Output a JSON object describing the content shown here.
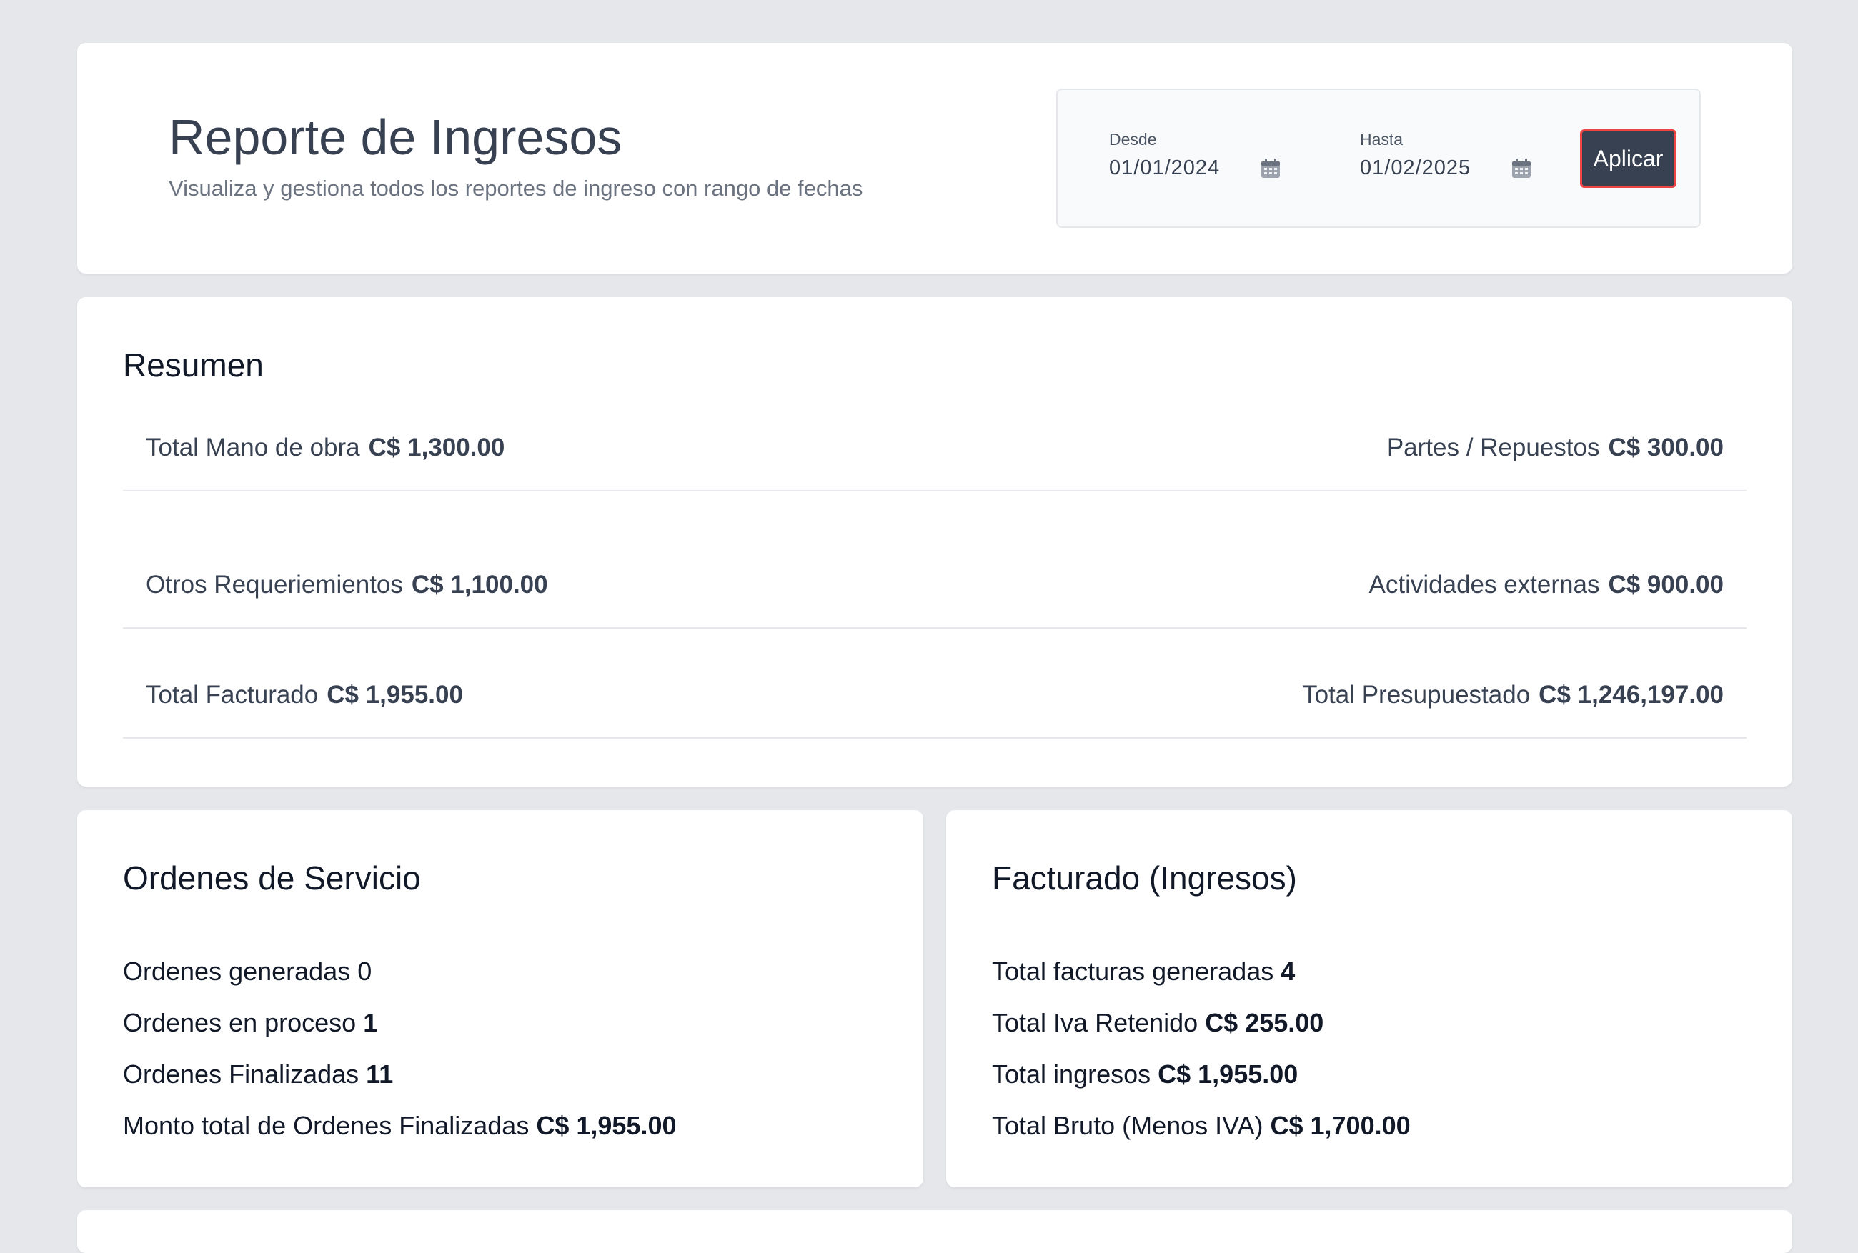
{
  "header": {
    "title": "Reporte de Ingresos",
    "subtitle": "Visualiza y gestiona todos los reportes de ingreso con rango de fechas"
  },
  "date_filter": {
    "from_label": "Desde",
    "from_value": "01/01/2024",
    "to_label": "Hasta",
    "to_value": "01/02/2025",
    "apply_label": "Aplicar"
  },
  "summary": {
    "title": "Resumen",
    "rows": [
      {
        "left": {
          "label": "Total Mano de obra",
          "value": "C$ 1,300.00"
        },
        "right": {
          "label": "Partes / Repuestos",
          "value": "C$ 300.00"
        }
      },
      {
        "left": {
          "label": "Otros Requeriemientos",
          "value": "C$ 1,100.00"
        },
        "right": {
          "label": "Actividades externas",
          "value": "C$ 900.00"
        }
      },
      {
        "left": {
          "label": "Total Facturado",
          "value": "C$ 1,955.00"
        },
        "right": {
          "label": "Total Presupuestado",
          "value": "C$ 1,246,197.00"
        }
      }
    ]
  },
  "orders": {
    "title": "Ordenes de Servicio",
    "items": [
      {
        "label": "Ordenes generadas",
        "value": "0"
      },
      {
        "label": "Ordenes en proceso",
        "value": "1"
      },
      {
        "label": "Ordenes Finalizadas",
        "value": "11"
      },
      {
        "label": "Monto total de Ordenes Finalizadas",
        "value": "C$ 1,955.00"
      }
    ]
  },
  "billing": {
    "title": "Facturado (Ingresos)",
    "items": [
      {
        "label": "Total facturas generadas",
        "value": "4"
      },
      {
        "label": "Total Iva Retenido",
        "value": "C$ 255.00"
      },
      {
        "label": "Total ingresos",
        "value": "C$ 1,955.00"
      },
      {
        "label": "Total Bruto (Menos IVA)",
        "value": "C$ 1,700.00"
      }
    ]
  },
  "icons": {
    "date_picker": "calendar-icon"
  },
  "colors": {
    "background": "#e5e7eb",
    "card": "#ffffff",
    "button": "#374151",
    "button_border": "#ef4444"
  }
}
